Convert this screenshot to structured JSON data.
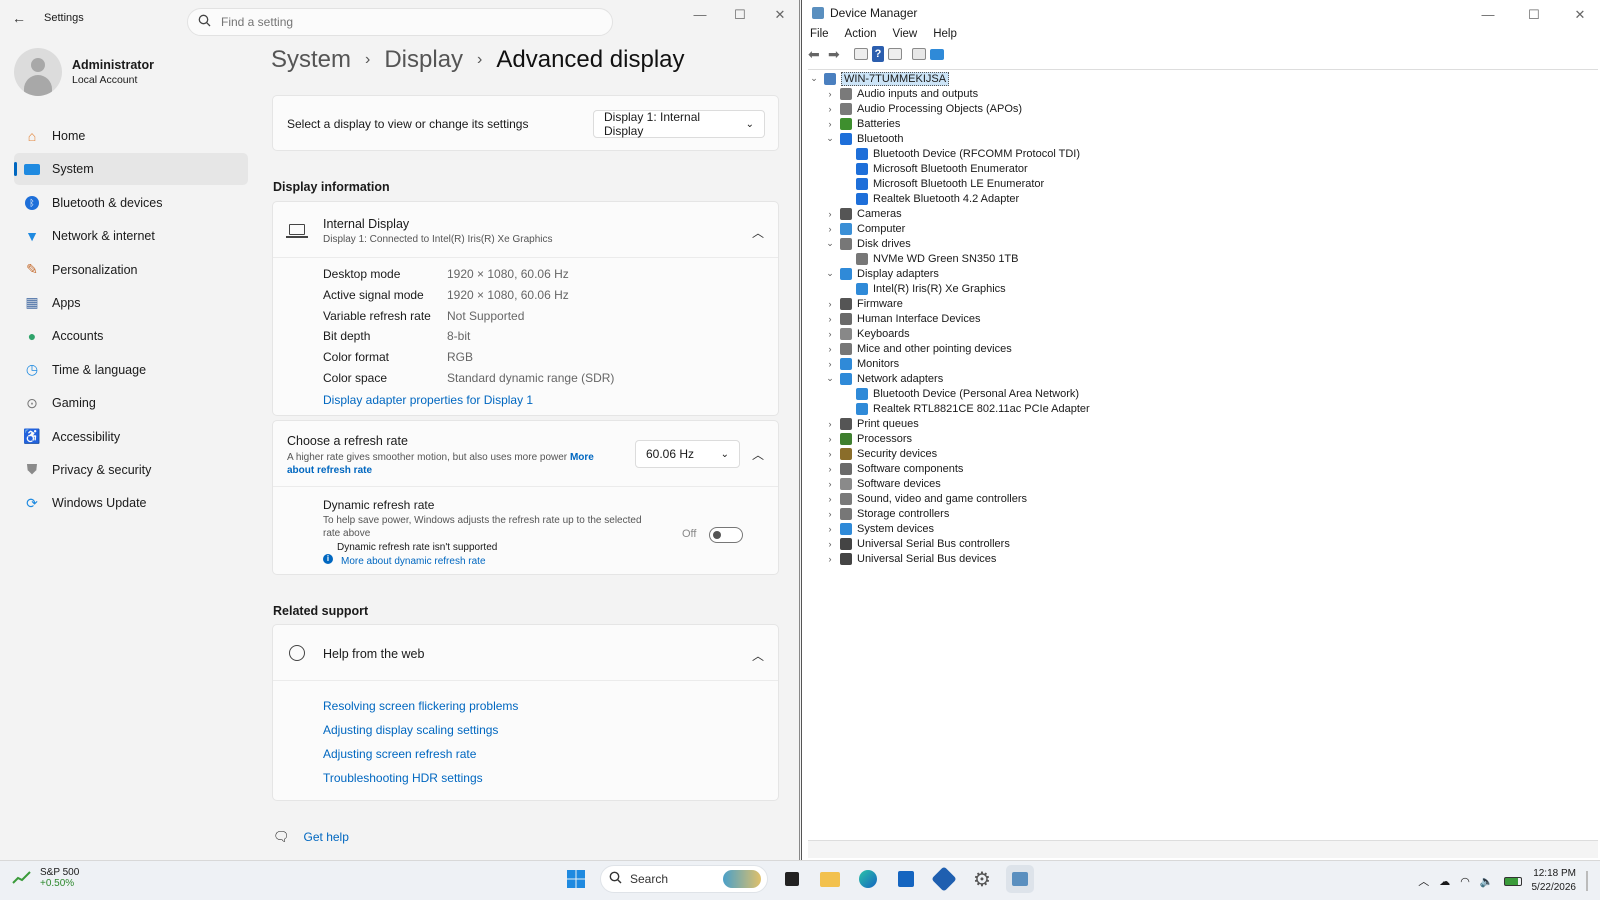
{
  "settings": {
    "app_title": "Settings",
    "search_placeholder": "Find a setting",
    "user": {
      "name": "Administrator",
      "account": "Local Account"
    },
    "nav": [
      {
        "label": "Home",
        "icon": "home-icon"
      },
      {
        "label": "System",
        "icon": "system-icon",
        "active": true
      },
      {
        "label": "Bluetooth & devices",
        "icon": "bluetooth-icon"
      },
      {
        "label": "Network & internet",
        "icon": "wifi-icon"
      },
      {
        "label": "Personalization",
        "icon": "brush-icon"
      },
      {
        "label": "Apps",
        "icon": "apps-icon"
      },
      {
        "label": "Accounts",
        "icon": "accounts-icon"
      },
      {
        "label": "Time & language",
        "icon": "globe-clock-icon"
      },
      {
        "label": "Gaming",
        "icon": "gamepad-icon"
      },
      {
        "label": "Accessibility",
        "icon": "accessibility-icon"
      },
      {
        "label": "Privacy & security",
        "icon": "shield-icon"
      },
      {
        "label": "Windows Update",
        "icon": "update-icon"
      }
    ],
    "breadcrumb": {
      "a": "System",
      "b": "Display",
      "c": "Advanced display"
    },
    "select_display": {
      "label": "Select a display to view or change its settings",
      "value": "Display 1: Internal Display"
    },
    "display_info": {
      "section": "Display information",
      "name": "Internal Display",
      "sub": "Display 1: Connected to Intel(R) Iris(R) Xe Graphics",
      "rows": [
        {
          "k": "Desktop mode",
          "v": "1920 × 1080, 60.06 Hz"
        },
        {
          "k": "Active signal mode",
          "v": "1920 × 1080, 60.06 Hz"
        },
        {
          "k": "Variable refresh rate",
          "v": "Not Supported"
        },
        {
          "k": "Bit depth",
          "v": "8-bit"
        },
        {
          "k": "Color format",
          "v": "RGB"
        },
        {
          "k": "Color space",
          "v": "Standard dynamic range (SDR)"
        }
      ],
      "adapter_link": "Display adapter properties for Display 1"
    },
    "refresh": {
      "title": "Choose a refresh rate",
      "desc": "A higher rate gives smoother motion, but also uses more power",
      "more_a": "More",
      "more_b": "about refresh rate",
      "value": "60.06 Hz",
      "dynamic_title": "Dynamic refresh rate",
      "dynamic_desc_a": "To help save power, Windows adjusts the refresh rate up to the selected",
      "dynamic_desc_b": "rate above",
      "toggle_label": "Off",
      "not_supported": "Dynamic refresh rate isn't supported",
      "more_dynamic": "More about dynamic refresh rate"
    },
    "related": {
      "section": "Related support",
      "help": "Help from the web",
      "links": [
        "Resolving screen flickering problems",
        "Adjusting display scaling settings",
        "Adjusting screen refresh rate",
        "Troubleshooting HDR settings"
      ],
      "get_help": "Get help"
    }
  },
  "device_manager": {
    "title": "Device Manager",
    "menu": [
      "File",
      "Action",
      "View",
      "Help"
    ],
    "root": "WIN-7TUMMEKIJSA",
    "tree": [
      {
        "label": "Audio inputs and outputs",
        "level": 1,
        "state": "collapsed",
        "icon": "speaker-icon",
        "color": "#7a7a7a"
      },
      {
        "label": "Audio Processing Objects (APOs)",
        "level": 1,
        "state": "collapsed",
        "icon": "speaker-icon",
        "color": "#7a7a7a"
      },
      {
        "label": "Batteries",
        "level": 1,
        "state": "collapsed",
        "icon": "battery-icon",
        "color": "#3e8f2e"
      },
      {
        "label": "Bluetooth",
        "level": 1,
        "state": "expanded",
        "icon": "bluetooth-icon",
        "color": "#1e6fd9"
      },
      {
        "label": "Bluetooth Device (RFCOMM Protocol TDI)",
        "level": 2,
        "state": "leaf",
        "icon": "bluetooth-icon",
        "color": "#1e6fd9"
      },
      {
        "label": "Microsoft Bluetooth Enumerator",
        "level": 2,
        "state": "leaf",
        "icon": "bluetooth-icon",
        "color": "#1e6fd9"
      },
      {
        "label": "Microsoft Bluetooth LE Enumerator",
        "level": 2,
        "state": "leaf",
        "icon": "bluetooth-icon",
        "color": "#1e6fd9"
      },
      {
        "label": "Realtek Bluetooth 4.2 Adapter",
        "level": 2,
        "state": "leaf",
        "icon": "bluetooth-icon",
        "color": "#1e6fd9"
      },
      {
        "label": "Cameras",
        "level": 1,
        "state": "collapsed",
        "icon": "camera-icon",
        "color": "#555555"
      },
      {
        "label": "Computer",
        "level": 1,
        "state": "collapsed",
        "icon": "computer-icon",
        "color": "#3a8fd6"
      },
      {
        "label": "Disk drives",
        "level": 1,
        "state": "expanded",
        "icon": "disk-icon",
        "color": "#777777"
      },
      {
        "label": "NVMe WD Green SN350 1TB",
        "level": 2,
        "state": "leaf",
        "icon": "disk-icon",
        "color": "#777777"
      },
      {
        "label": "Display adapters",
        "level": 1,
        "state": "expanded",
        "icon": "monitor-icon",
        "color": "#2f8ad8"
      },
      {
        "label": "Intel(R) Iris(R) Xe Graphics",
        "level": 2,
        "state": "leaf",
        "icon": "monitor-icon",
        "color": "#2f8ad8"
      },
      {
        "label": "Firmware",
        "level": 1,
        "state": "collapsed",
        "icon": "chip-icon",
        "color": "#555555"
      },
      {
        "label": "Human Interface Devices",
        "level": 1,
        "state": "collapsed",
        "icon": "hid-icon",
        "color": "#6a6a6a"
      },
      {
        "label": "Keyboards",
        "level": 1,
        "state": "collapsed",
        "icon": "keyboard-icon",
        "color": "#888888"
      },
      {
        "label": "Mice and other pointing devices",
        "level": 1,
        "state": "collapsed",
        "icon": "mouse-icon",
        "color": "#777777"
      },
      {
        "label": "Monitors",
        "level": 1,
        "state": "collapsed",
        "icon": "monitor-icon",
        "color": "#2f8ad8"
      },
      {
        "label": "Network adapters",
        "level": 1,
        "state": "expanded",
        "icon": "network-icon",
        "color": "#2f8ad8"
      },
      {
        "label": "Bluetooth Device (Personal Area Network)",
        "level": 2,
        "state": "leaf",
        "icon": "network-icon",
        "color": "#2f8ad8"
      },
      {
        "label": "Realtek RTL8821CE 802.11ac PCIe Adapter",
        "level": 2,
        "state": "leaf",
        "icon": "network-icon",
        "color": "#2f8ad8"
      },
      {
        "label": "Print queues",
        "level": 1,
        "state": "collapsed",
        "icon": "printer-icon",
        "color": "#555555"
      },
      {
        "label": "Processors",
        "level": 1,
        "state": "collapsed",
        "icon": "cpu-icon",
        "color": "#3f7f2f"
      },
      {
        "label": "Security devices",
        "level": 1,
        "state": "collapsed",
        "icon": "security-icon",
        "color": "#8a6d2a"
      },
      {
        "label": "Software components",
        "level": 1,
        "state": "collapsed",
        "icon": "component-icon",
        "color": "#6a6a6a"
      },
      {
        "label": "Software devices",
        "level": 1,
        "state": "collapsed",
        "icon": "software-device-icon",
        "color": "#8a8a8a"
      },
      {
        "label": "Sound, video and game controllers",
        "level": 1,
        "state": "collapsed",
        "icon": "speaker-icon",
        "color": "#7a7a7a"
      },
      {
        "label": "Storage controllers",
        "level": 1,
        "state": "collapsed",
        "icon": "storage-icon",
        "color": "#777777"
      },
      {
        "label": "System devices",
        "level": 1,
        "state": "collapsed",
        "icon": "system-device-icon",
        "color": "#2f8ad8"
      },
      {
        "label": "Universal Serial Bus controllers",
        "level": 1,
        "state": "collapsed",
        "icon": "usb-icon",
        "color": "#444444"
      },
      {
        "label": "Universal Serial Bus devices",
        "level": 1,
        "state": "collapsed",
        "icon": "usb-icon",
        "color": "#444444"
      }
    ]
  },
  "taskbar": {
    "stock": {
      "name": "S&P 500",
      "change": "+0.50%"
    },
    "search": "Search",
    "time": "12:18 PM",
    "date": "5/22/2026"
  },
  "colors": {
    "accent": "#0067c0",
    "link": "#0067c0"
  }
}
